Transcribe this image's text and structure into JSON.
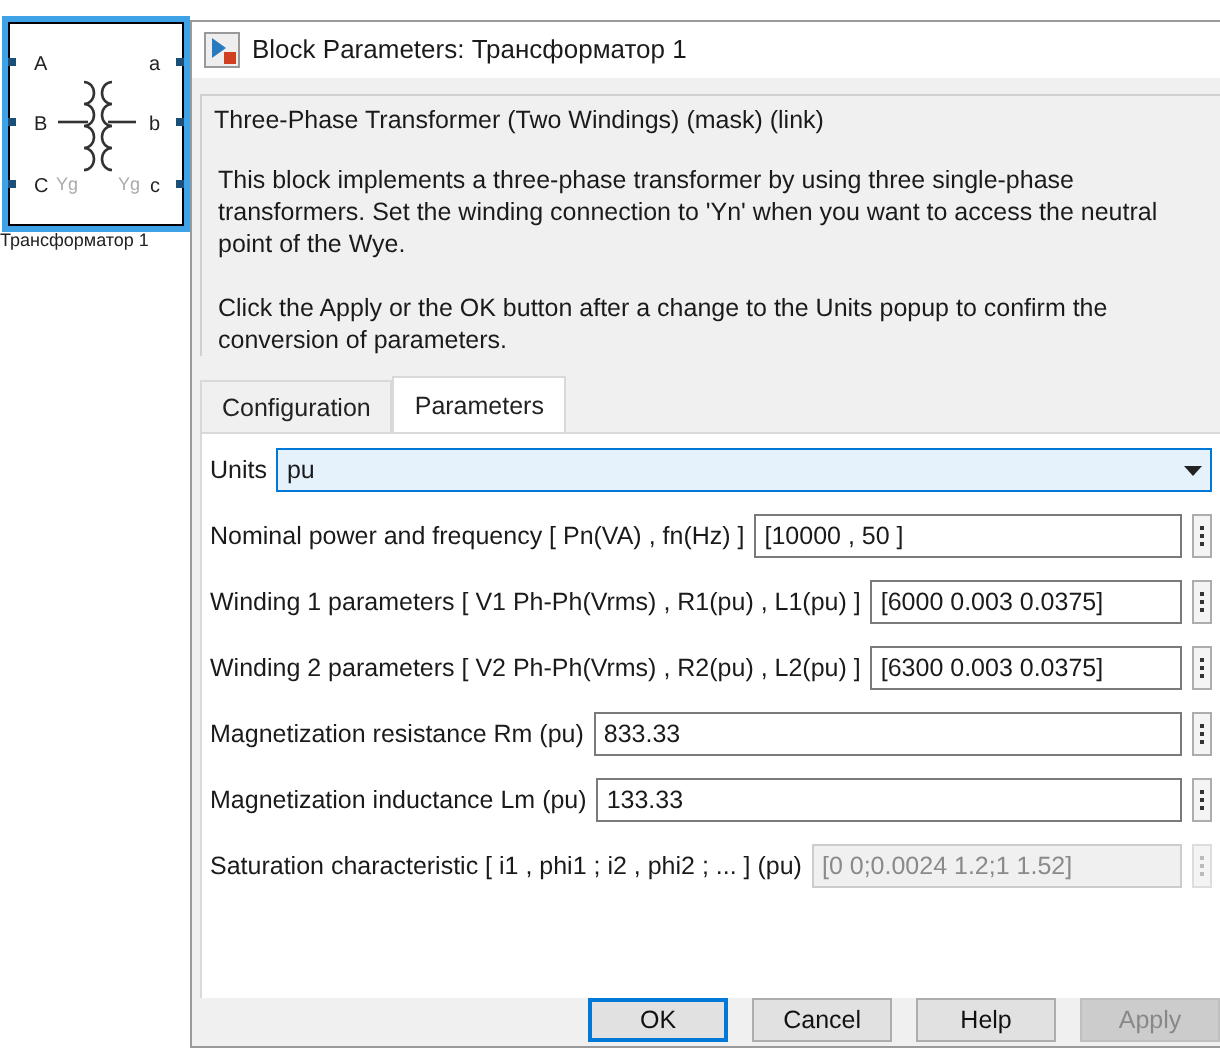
{
  "block": {
    "label": "Трансформатор 1",
    "selected": true,
    "left_ports": [
      "A",
      "B",
      "C"
    ],
    "right_ports": [
      "a",
      "b",
      "c"
    ],
    "windings": [
      "Yg",
      "Yg"
    ]
  },
  "window": {
    "title": "Block Parameters: Трансформатор 1"
  },
  "group": {
    "title": "Three-Phase Transformer (Two Windings) (mask) (link)",
    "paragraphs": [
      "This block implements a three-phase transformer by using three single-phase transformers. Set the winding connection to 'Yn'  when you want to access the neutral point of the Wye.",
      "Click the Apply or the OK button after a change to the Units popup to confirm the conversion of parameters."
    ]
  },
  "tabs": [
    {
      "label": "Configuration",
      "selected": false
    },
    {
      "label": "Parameters",
      "selected": true
    }
  ],
  "units": {
    "label": "Units",
    "value": "pu"
  },
  "fields": [
    {
      "label": "Nominal power and frequency  [ Pn(VA) , fn(Hz) ]",
      "value": "[10000 , 50 ]",
      "disabled": false
    },
    {
      "label": "Winding 1 parameters [ V1 Ph-Ph(Vrms) , R1(pu) , L1(pu) ]",
      "value": "[6000 0.003 0.0375]",
      "disabled": false
    },
    {
      "label": "Winding 2 parameters [ V2 Ph-Ph(Vrms) , R2(pu) , L2(pu) ]",
      "value": "[6300 0.003 0.0375]",
      "disabled": false
    },
    {
      "label": "Magnetization resistance  Rm (pu)",
      "value": "833.33",
      "disabled": false
    },
    {
      "label": "Magnetization inductance  Lm (pu)",
      "value": "133.33",
      "disabled": false
    },
    {
      "label": "Saturation characteristic [ i1 ,  phi1 ;  i2 , phi2 ; ... ] (pu)",
      "value": "[0 0;0.0024 1.2;1 1.52]",
      "disabled": true
    }
  ],
  "buttons": [
    {
      "label": "OK",
      "focused": true,
      "disabled": false
    },
    {
      "label": "Cancel",
      "focused": false,
      "disabled": false
    },
    {
      "label": "Help",
      "focused": false,
      "disabled": false
    },
    {
      "label": "Apply",
      "focused": false,
      "disabled": true
    }
  ]
}
